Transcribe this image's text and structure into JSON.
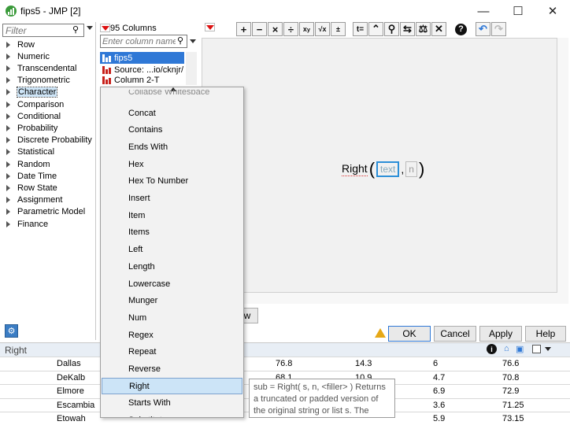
{
  "window": {
    "title": "fips5 - JMP [2]",
    "minimize_icon": "minimize-icon",
    "maximize_icon": "maximize-icon",
    "close_icon": "close-icon"
  },
  "functions_panel": {
    "filter_placeholder": "Filter",
    "categories": [
      "Row",
      "Numeric",
      "Transcendental",
      "Trigonometric",
      "Character",
      "Comparison",
      "Conditional",
      "Probability",
      "Discrete Probability",
      "Statistical",
      "Random",
      "Date Time",
      "Row State",
      "Assignment",
      "Parametric Model",
      "Finance"
    ],
    "selected": "Character"
  },
  "columns_panel": {
    "count_label": "95 Columns",
    "search_placeholder": "Enter column name",
    "items": [
      "fips5",
      "Source: ...io/cknjr/",
      "Column  2-T"
    ]
  },
  "formula": {
    "function_name": "Right",
    "arg1_placeholder": "text",
    "arg2_placeholder": "n"
  },
  "dropdown": {
    "partial_top": "Collapse Whitespace",
    "items": [
      "Concat",
      "Contains",
      "Ends With",
      "Hex",
      "Hex To Number",
      "Insert",
      "Item",
      "Items",
      "Left",
      "Length",
      "Lowercase",
      "Munger",
      "Num",
      "Regex",
      "Repeat",
      "Reverse",
      "Right",
      "Starts With",
      "Substitute"
    ],
    "highlighted": "Right"
  },
  "buttons": {
    "ok": "OK",
    "cancel": "Cancel",
    "apply": "Apply",
    "help": "Help",
    "partial": "w"
  },
  "status": {
    "text": "Right"
  },
  "tooltip": {
    "text": "sub = Right( s, n, <filler> ) Returns a truncated or padded version of the original string or list s. The result contains the..."
  },
  "table_rows": [
    {
      "name": "Dallas",
      "c1": "76.8",
      "c2": "14.3",
      "c3": "6",
      "c4": "76.6"
    },
    {
      "name": "DeKalb",
      "c1": "68.1",
      "c2": "10.9",
      "c3": "4.7",
      "c4": "70.8"
    },
    {
      "name": "Elmore",
      "c1": "",
      "c2": "",
      "c3": "6.9",
      "c4": "72.9"
    },
    {
      "name": "Escambia",
      "c1": "",
      "c2": "",
      "c3": "3.6",
      "c4": "71.25"
    },
    {
      "name": "Etowah",
      "c1": "",
      "c2": "",
      "c3": "5.9",
      "c4": "73.15"
    }
  ],
  "colors": {
    "accent": "#2f78d6",
    "highlight": "#cce4f7",
    "red_marker": "#d11111"
  }
}
